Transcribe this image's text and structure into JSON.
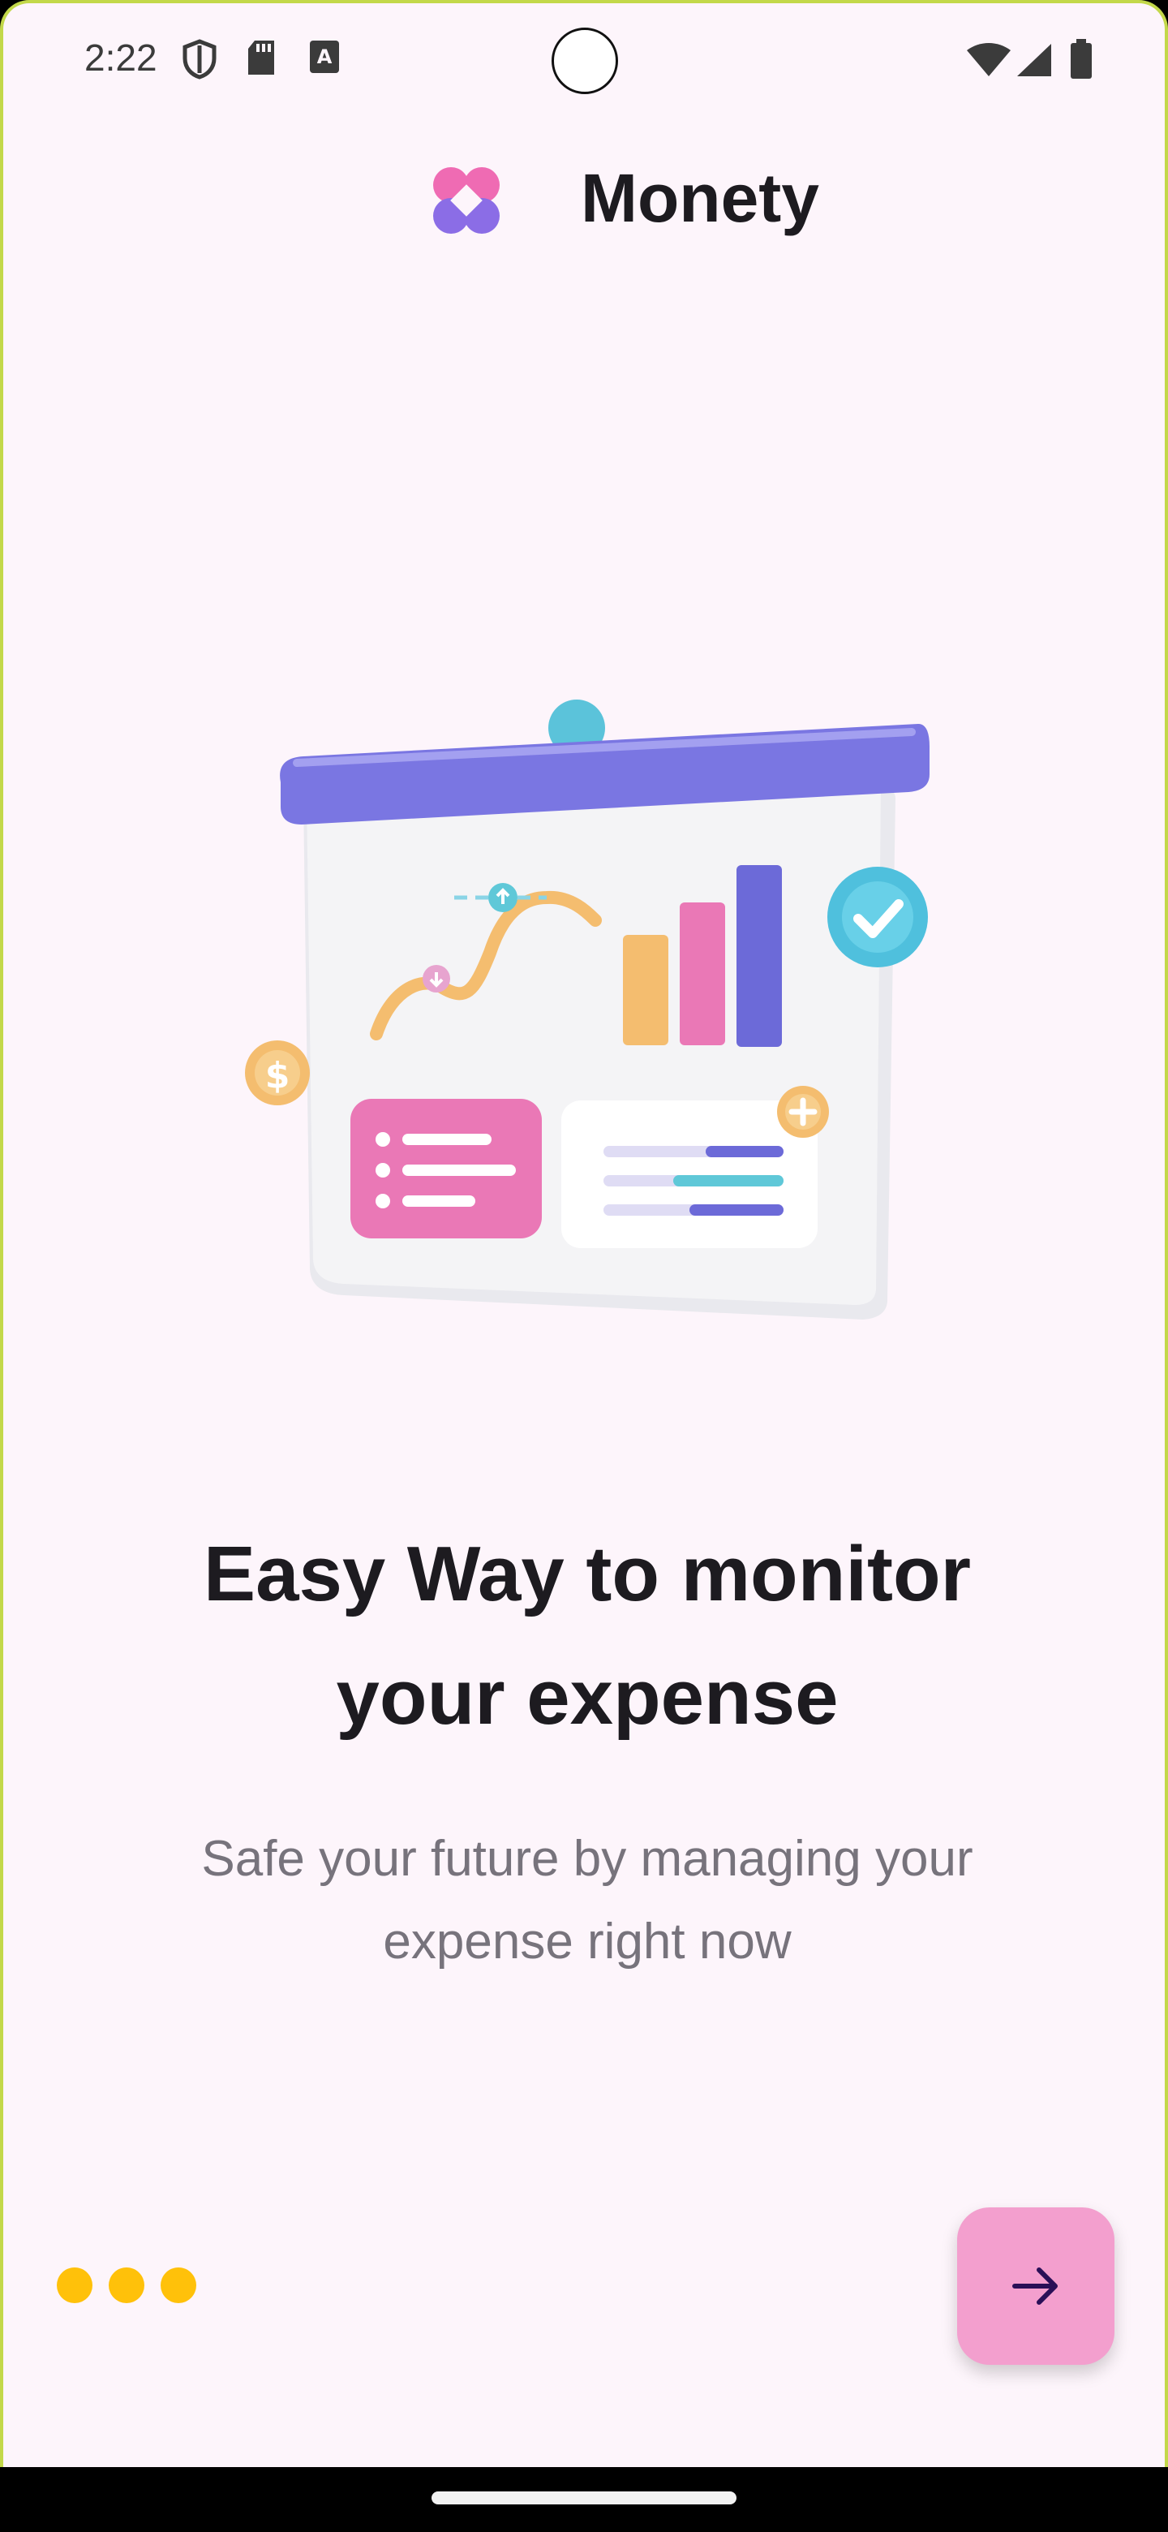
{
  "status_bar": {
    "time": "2:22",
    "icons": [
      "shield-icon",
      "sd-card-icon",
      "font-a-icon",
      "wifi-icon",
      "signal-icon",
      "battery-icon"
    ]
  },
  "header": {
    "title": "Monety",
    "logo_icon": "monety-logo-icon"
  },
  "illustration": {
    "name": "presentation-board-illustration",
    "colors": {
      "board": "#f4f4f6",
      "roller": "#7a76e2",
      "pin": "#5bc3da",
      "pink": "#ea78b6",
      "orange": "#f4bd6f",
      "purple": "#6c6ad8",
      "teal": "#5fc8d8",
      "check_badge": "#4fc0dd"
    }
  },
  "onboarding": {
    "headline_line1": "Easy Way to monitor",
    "headline_line2": "your expense",
    "subtitle_line1": "Safe your future by managing your",
    "subtitle_line2": "expense right now"
  },
  "pager": {
    "dot_count": 3,
    "dot_color": "#ffc10a"
  },
  "next_button": {
    "icon": "arrow-right-icon",
    "color": "#f39fce",
    "icon_color": "#2a0f57"
  }
}
